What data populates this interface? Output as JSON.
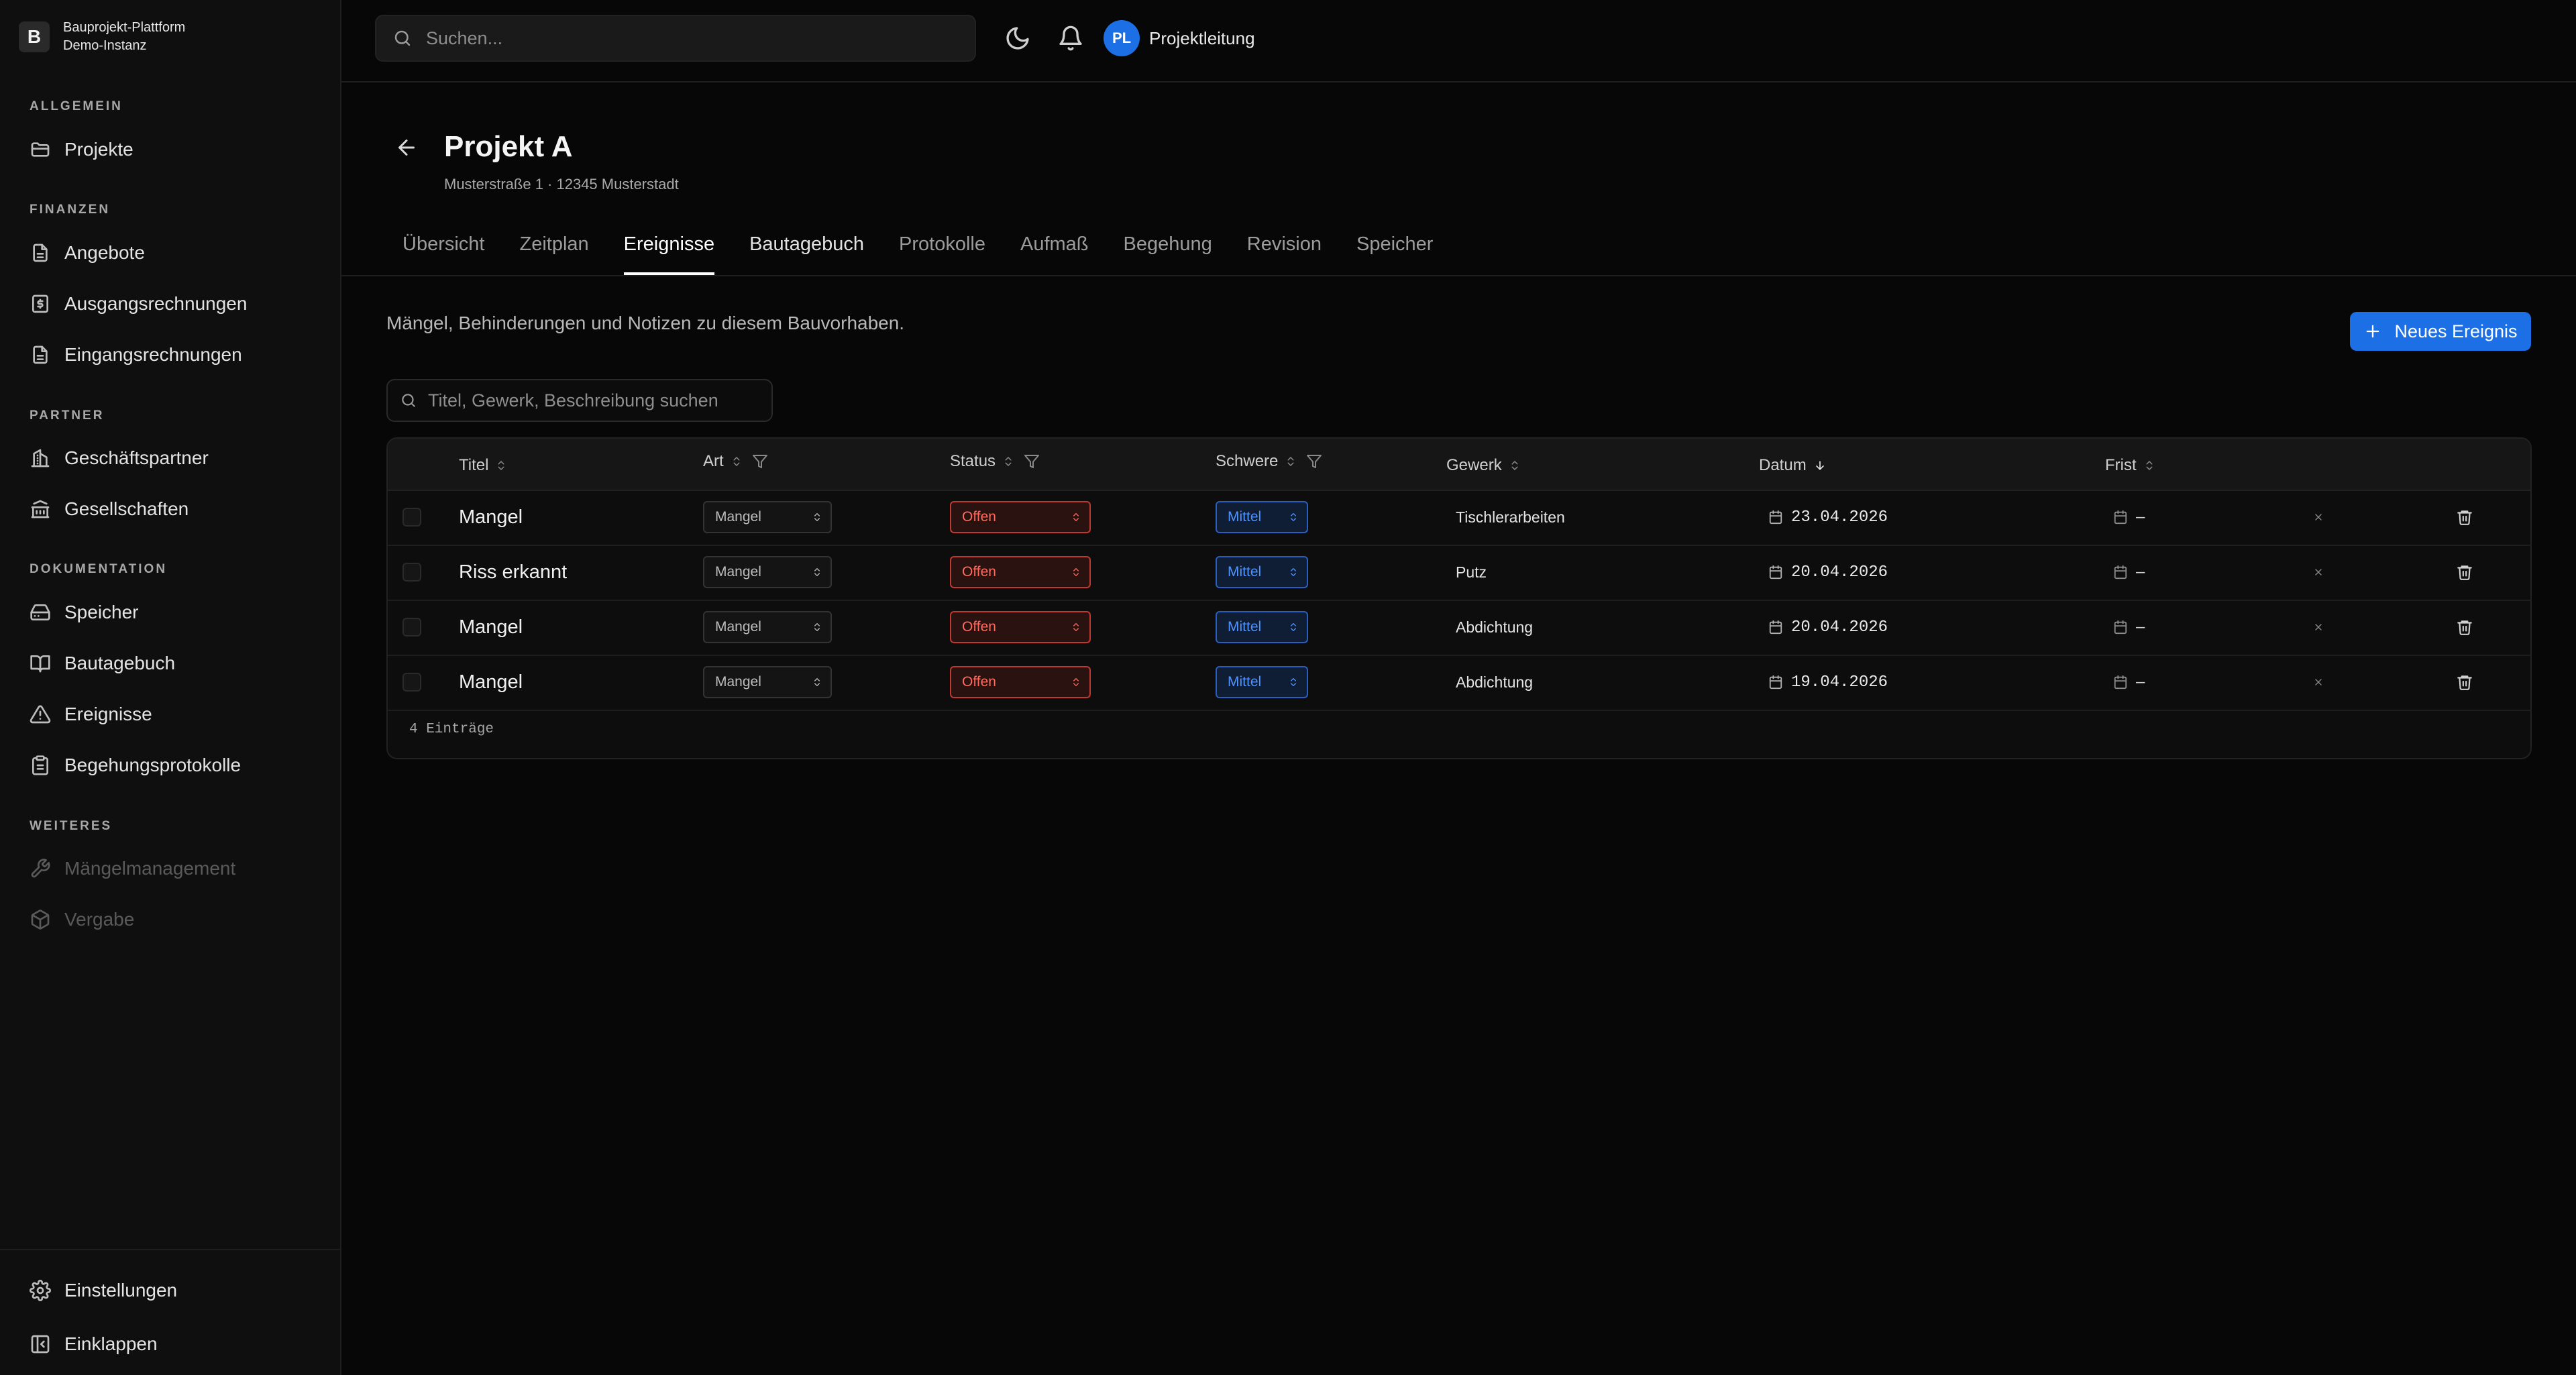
{
  "brand": {
    "logo_letter": "B",
    "name": "Bauprojekt-Plattform",
    "instance": "Demo-Instanz"
  },
  "sidebar": {
    "sections": [
      {
        "label": "ALLGEMEIN",
        "items": [
          {
            "label": "Projekte",
            "icon": "folder-icon"
          }
        ]
      },
      {
        "label": "FINANZEN",
        "items": [
          {
            "label": "Angebote",
            "icon": "document-icon"
          },
          {
            "label": "Ausgangsrechnungen",
            "icon": "invoice-dollar-icon"
          },
          {
            "label": "Eingangsrechnungen",
            "icon": "document-icon"
          }
        ]
      },
      {
        "label": "PARTNER",
        "items": [
          {
            "label": "Geschäftspartner",
            "icon": "building-icon"
          },
          {
            "label": "Gesellschaften",
            "icon": "bank-icon"
          }
        ]
      },
      {
        "label": "DOKUMENTATION",
        "items": [
          {
            "label": "Speicher",
            "icon": "storage-icon"
          },
          {
            "label": "Bautagebuch",
            "icon": "book-icon"
          },
          {
            "label": "Ereignisse",
            "icon": "warning-icon"
          },
          {
            "label": "Begehungsprotokolle",
            "icon": "clipboard-icon"
          }
        ]
      },
      {
        "label": "WEITERES",
        "items": [
          {
            "label": "Mängelmanagement",
            "icon": "wrench-icon",
            "disabled": true
          },
          {
            "label": "Vergabe",
            "icon": "package-icon",
            "disabled": true
          }
        ]
      }
    ],
    "bottom": [
      {
        "label": "Einstellungen",
        "icon": "gear-icon"
      },
      {
        "label": "Einklappen",
        "icon": "collapse-sidebar-icon"
      }
    ]
  },
  "topbar": {
    "search_placeholder": "Suchen...",
    "avatar_initials": "PL",
    "user_name": "Projektleitung"
  },
  "project": {
    "title": "Projekt A",
    "address": "Musterstraße 1 · 12345 Musterstadt"
  },
  "tabs": [
    {
      "label": "Übersicht"
    },
    {
      "label": "Zeitplan"
    },
    {
      "label": "Ereignisse",
      "active": true
    },
    {
      "label": "Bautagebuch"
    },
    {
      "label": "Protokolle"
    },
    {
      "label": "Aufmaß"
    },
    {
      "label": "Begehung"
    },
    {
      "label": "Revision"
    },
    {
      "label": "Speicher"
    }
  ],
  "events": {
    "description": "Mängel, Behinderungen und Notizen zu diesem Bauvorhaben.",
    "new_button": "Neues Ereignis",
    "search_placeholder": "Titel, Gewerk, Beschreibung suchen",
    "columns": [
      "Titel",
      "Art",
      "Status",
      "Schwere",
      "Gewerk",
      "Datum",
      "Frist"
    ],
    "rows": [
      {
        "titel": "Mangel",
        "art": "Mangel",
        "status": "Offen",
        "schwere": "Mittel",
        "gewerk": "Tischlerarbeiten",
        "datum": "23.04.2026",
        "frist": "–"
      },
      {
        "titel": "Riss erkannt",
        "art": "Mangel",
        "status": "Offen",
        "schwere": "Mittel",
        "gewerk": "Putz",
        "datum": "20.04.2026",
        "frist": "–"
      },
      {
        "titel": "Mangel",
        "art": "Mangel",
        "status": "Offen",
        "schwere": "Mittel",
        "gewerk": "Abdichtung",
        "datum": "20.04.2026",
        "frist": "–"
      },
      {
        "titel": "Mangel",
        "art": "Mangel",
        "status": "Offen",
        "schwere": "Mittel",
        "gewerk": "Abdichtung",
        "datum": "19.04.2026",
        "frist": "–"
      }
    ],
    "count": "4 Einträge"
  },
  "colors": {
    "accent": "#1d6fe6",
    "status_open": "#ff6b5e",
    "severity_medium": "#4f93ff",
    "background": "#070707"
  }
}
